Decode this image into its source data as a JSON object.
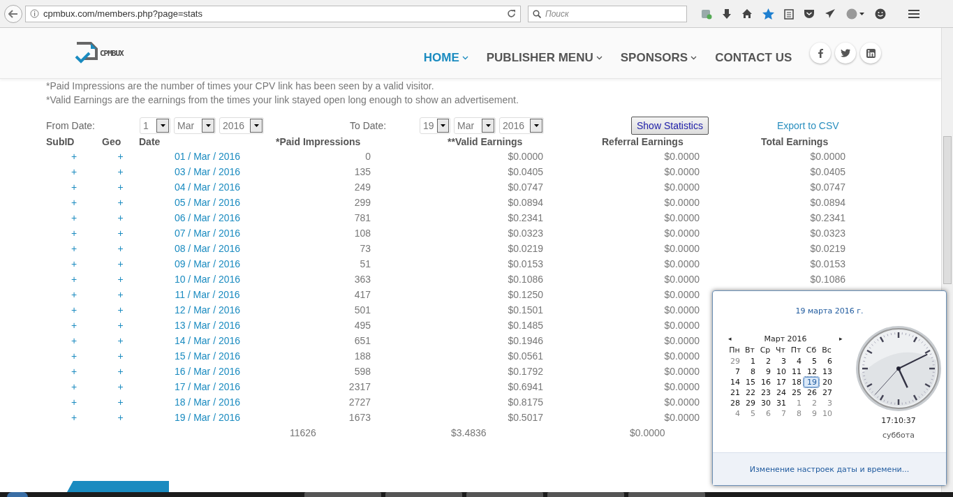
{
  "browser": {
    "url": "cpmbux.com/members.php?page=stats",
    "search_placeholder": "Поиск"
  },
  "site": {
    "logo": "CPMBUX",
    "nav": [
      {
        "label": "HOME",
        "selected": true,
        "dropdown": true
      },
      {
        "label": "PUBLISHER MENU",
        "selected": false,
        "dropdown": true
      },
      {
        "label": "SPONSORS",
        "selected": false,
        "dropdown": true
      },
      {
        "label": "CONTACT US",
        "selected": false,
        "dropdown": false
      }
    ],
    "social": [
      {
        "kind": "facebook"
      },
      {
        "kind": "twitter"
      },
      {
        "kind": "linkedin"
      }
    ]
  },
  "notes": [
    "*Paid Impressions are the number of times your CPV link has been seen by a valid visitor.",
    "*Valid Earnings are the earnings from the times your link stayed open long enough to show an advertisement."
  ],
  "filter": {
    "from_label": "From Date:",
    "from": [
      "1",
      "Mar",
      "2016"
    ],
    "to_label": "To Date:",
    "to": [
      "19",
      "Mar",
      "2016"
    ],
    "button": "Show Statistics",
    "export": "Export to CSV"
  },
  "table": {
    "columns": [
      "SubID",
      "Geo",
      "Date",
      "*Paid Impressions",
      "**Valid Earnings",
      "Referral Earnings",
      "Total Earnings"
    ],
    "rows": [
      [
        "+",
        "+",
        "01 / Mar / 2016",
        "0",
        "$0.0000",
        "$0.0000",
        "$0.0000"
      ],
      [
        "+",
        "+",
        "03 / Mar / 2016",
        "135",
        "$0.0405",
        "$0.0000",
        "$0.0405"
      ],
      [
        "+",
        "+",
        "04 / Mar / 2016",
        "249",
        "$0.0747",
        "$0.0000",
        "$0.0747"
      ],
      [
        "+",
        "+",
        "05 / Mar / 2016",
        "299",
        "$0.0894",
        "$0.0000",
        "$0.0894"
      ],
      [
        "+",
        "+",
        "06 / Mar / 2016",
        "781",
        "$0.2341",
        "$0.0000",
        "$0.2341"
      ],
      [
        "+",
        "+",
        "07 / Mar / 2016",
        "108",
        "$0.0323",
        "$0.0000",
        "$0.0323"
      ],
      [
        "+",
        "+",
        "08 / Mar / 2016",
        "73",
        "$0.0219",
        "$0.0000",
        "$0.0219"
      ],
      [
        "+",
        "+",
        "09 / Mar / 2016",
        "51",
        "$0.0153",
        "$0.0000",
        "$0.0153"
      ],
      [
        "+",
        "+",
        "10 / Mar / 2016",
        "363",
        "$0.1086",
        "$0.0000",
        "$0.1086"
      ],
      [
        "+",
        "+",
        "11 / Mar / 2016",
        "417",
        "$0.1250",
        "$0.0000"
      ],
      [
        "+",
        "+",
        "12 / Mar / 2016",
        "501",
        "$0.1501",
        "$0.0000"
      ],
      [
        "+",
        "+",
        "13 / Mar / 2016",
        "495",
        "$0.1485",
        "$0.0000"
      ],
      [
        "+",
        "+",
        "14 / Mar / 2016",
        "651",
        "$0.1946",
        "$0.0000"
      ],
      [
        "+",
        "+",
        "15 / Mar / 2016",
        "188",
        "$0.0561",
        "$0.0000"
      ],
      [
        "+",
        "+",
        "16 / Mar / 2016",
        "598",
        "$0.1792",
        "$0.0000"
      ],
      [
        "+",
        "+",
        "17 / Mar / 2016",
        "2317",
        "$0.6941",
        "$0.0000"
      ],
      [
        "+",
        "+",
        "18 / Mar / 2016",
        "2727",
        "$0.8175",
        "$0.0000"
      ],
      [
        "+",
        "+",
        "19 / Mar / 2016",
        "1673",
        "$0.5017",
        "$0.0000"
      ]
    ],
    "totals": [
      "11626",
      "$3.4836",
      "$0.0000"
    ]
  },
  "calendar": {
    "date_title": "19 марта 2016 г.",
    "prev": "◂",
    "month": "Март 2016",
    "next": "▸",
    "weekdays": [
      "Пн",
      "Вт",
      "Ср",
      "Чт",
      "Пт",
      "Сб",
      "Вс"
    ],
    "weeks": [
      [
        {
          "day": "29",
          "muted": true,
          "selected": false
        },
        {
          "day": "1",
          "muted": false,
          "selected": false
        },
        {
          "day": "2",
          "muted": false,
          "selected": false
        },
        {
          "day": "3",
          "muted": false,
          "selected": false
        },
        {
          "day": "4",
          "muted": false,
          "selected": false
        },
        {
          "day": "5",
          "muted": false,
          "selected": false
        },
        {
          "day": "6",
          "muted": false,
          "selected": false
        }
      ],
      [
        {
          "day": "7",
          "muted": false,
          "selected": false
        },
        {
          "day": "8",
          "muted": false,
          "selected": false
        },
        {
          "day": "9",
          "muted": false,
          "selected": false
        },
        {
          "day": "10",
          "muted": false,
          "selected": false
        },
        {
          "day": "11",
          "muted": false,
          "selected": false
        },
        {
          "day": "12",
          "muted": false,
          "selected": false
        },
        {
          "day": "13",
          "muted": false,
          "selected": false
        }
      ],
      [
        {
          "day": "14",
          "muted": false,
          "selected": false
        },
        {
          "day": "15",
          "muted": false,
          "selected": false
        },
        {
          "day": "16",
          "muted": false,
          "selected": false
        },
        {
          "day": "17",
          "muted": false,
          "selected": false
        },
        {
          "day": "18",
          "muted": false,
          "selected": false
        },
        {
          "day": "19",
          "muted": false,
          "selected": true
        },
        {
          "day": "20",
          "muted": false,
          "selected": false
        }
      ],
      [
        {
          "day": "21",
          "muted": false,
          "selected": false
        },
        {
          "day": "22",
          "muted": false,
          "selected": false
        },
        {
          "day": "23",
          "muted": false,
          "selected": false
        },
        {
          "day": "24",
          "muted": false,
          "selected": false
        },
        {
          "day": "25",
          "muted": false,
          "selected": false
        },
        {
          "day": "26",
          "muted": false,
          "selected": false
        },
        {
          "day": "27",
          "muted": false,
          "selected": false
        }
      ],
      [
        {
          "day": "28",
          "muted": false,
          "selected": false
        },
        {
          "day": "29",
          "muted": false,
          "selected": false
        },
        {
          "day": "30",
          "muted": false,
          "selected": false
        },
        {
          "day": "31",
          "muted": false,
          "selected": false
        },
        {
          "day": "1",
          "muted": true,
          "selected": false
        },
        {
          "day": "2",
          "muted": true,
          "selected": false
        },
        {
          "day": "3",
          "muted": true,
          "selected": false
        }
      ],
      [
        {
          "day": "4",
          "muted": true,
          "selected": false
        },
        {
          "day": "5",
          "muted": true,
          "selected": false
        },
        {
          "day": "6",
          "muted": true,
          "selected": false
        },
        {
          "day": "7",
          "muted": true,
          "selected": false
        },
        {
          "day": "8",
          "muted": true,
          "selected": false
        },
        {
          "day": "9",
          "muted": true,
          "selected": false
        },
        {
          "day": "10",
          "muted": true,
          "selected": false
        }
      ]
    ],
    "time": "17:10:37",
    "weekday": "суббота",
    "settings_link": "Изменение настроек даты и времени..."
  }
}
